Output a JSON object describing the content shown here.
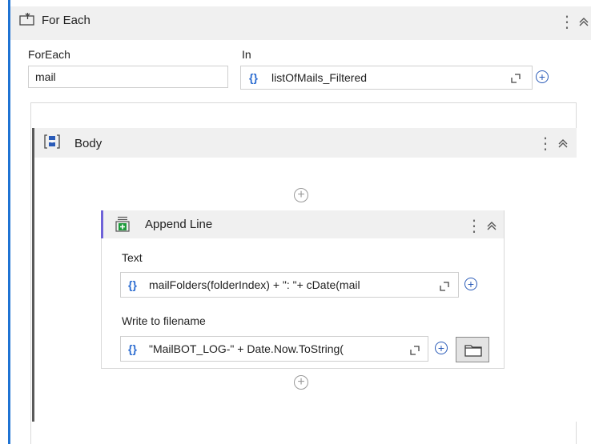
{
  "for_each": {
    "title": "For Each",
    "item_label": "ForEach",
    "item_value": "mail",
    "in_label": "In",
    "in_value": "listOfMails_Filtered"
  },
  "body": {
    "title": "Body"
  },
  "append_line": {
    "title": "Append Line",
    "text_label": "Text",
    "text_value": "mailFolders(folderIndex) + \": \"+ cDate(mail",
    "filename_label": "Write to filename",
    "filename_value": "\"MailBOT_LOG-\" + Date.Now.ToString("
  },
  "glyphs": {
    "brace": "{}",
    "kebab": "⋮",
    "collapse": "︽",
    "plus": "+"
  },
  "colors": {
    "for_each_accent": "#1f73d3",
    "append_line_accent": "#6e62d8",
    "expression_brace": "#2a6bd0"
  }
}
